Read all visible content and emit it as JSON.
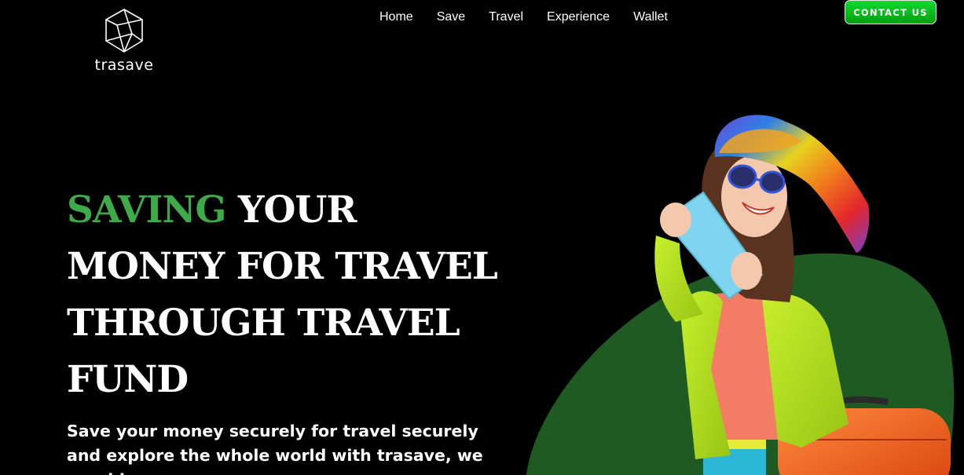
{
  "brand": {
    "name": "trasave",
    "icon": "cube-logo-icon"
  },
  "nav": {
    "items": [
      {
        "label": "Home"
      },
      {
        "label": "Save"
      },
      {
        "label": "Travel"
      },
      {
        "label": "Experience"
      },
      {
        "label": "Wallet"
      }
    ]
  },
  "header": {
    "contact_label": "CONTACT US"
  },
  "hero": {
    "title_accent": "SAVING",
    "title_rest_1": "YOUR",
    "title_line_2": "MONEY FOR TRAVEL",
    "title_line_3": "THROUGH TRAVEL",
    "title_line_4": "FUND",
    "subtitle": "Save your money securely for travel securely and explore the whole world with trasave, we provide",
    "image": "woman-traveler-with-suitcase-and-ticket"
  },
  "colors": {
    "background": "#000000",
    "accent": "#3faa4a",
    "button": "#06b81a",
    "blob": "#1f5a22"
  }
}
